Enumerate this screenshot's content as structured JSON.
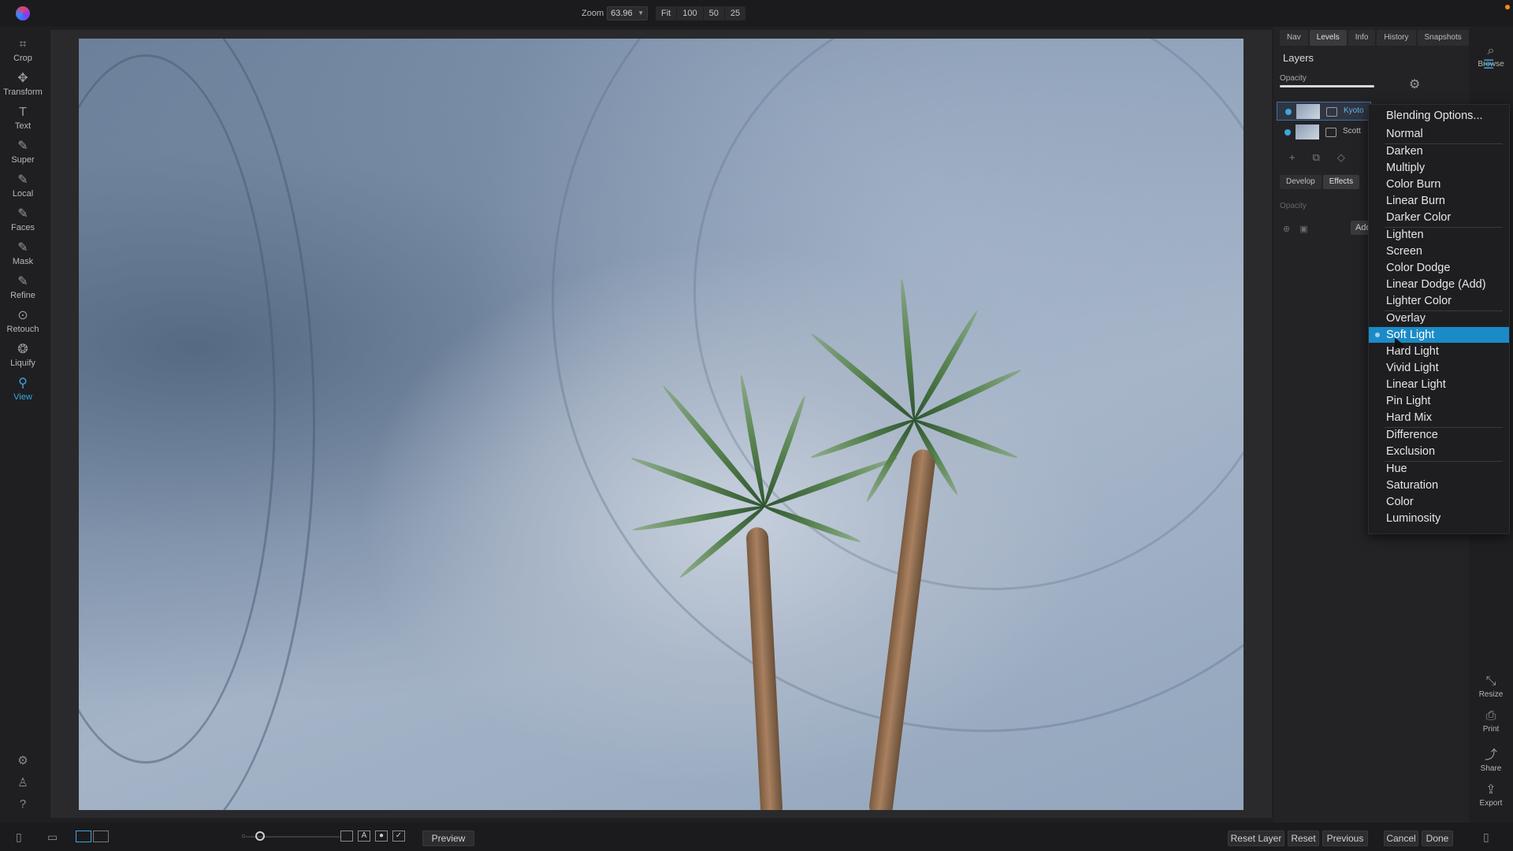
{
  "topbar": {
    "zoom_label": "Zoom",
    "zoom_value": "63.96",
    "zoom_presets": [
      "Fit",
      "100",
      "50",
      "25"
    ]
  },
  "tools": [
    {
      "label": "Crop",
      "icon": "crop-icon",
      "glyph": "⌗"
    },
    {
      "label": "Transform",
      "icon": "transform-icon",
      "glyph": "✥"
    },
    {
      "label": "Text",
      "icon": "text-icon",
      "glyph": "T"
    },
    {
      "label": "Super",
      "icon": "super-brush-icon",
      "glyph": "✎"
    },
    {
      "label": "Local",
      "icon": "local-brush-icon",
      "glyph": "✎"
    },
    {
      "label": "Faces",
      "icon": "faces-icon",
      "glyph": "✎"
    },
    {
      "label": "Mask",
      "icon": "mask-brush-icon",
      "glyph": "✎"
    },
    {
      "label": "Refine",
      "icon": "refine-icon",
      "glyph": "✎"
    },
    {
      "label": "Retouch",
      "icon": "retouch-icon",
      "glyph": "⊙"
    },
    {
      "label": "Liquify",
      "icon": "liquify-icon",
      "glyph": "❂"
    },
    {
      "label": "View",
      "icon": "view-icon",
      "glyph": "⚲"
    }
  ],
  "panel": {
    "tabs": [
      "Nav",
      "Levels",
      "Info",
      "History",
      "Snapshots"
    ],
    "active_tab": "Levels",
    "title": "Layers",
    "opacity_label": "Opacity",
    "layers": [
      {
        "name": "Kyoto",
        "selected": true
      },
      {
        "name": "Scott",
        "selected": false
      }
    ],
    "sub_tabs": [
      "Develop",
      "Effects"
    ],
    "sub_opacity_label": "Opacity",
    "add_label": "Add"
  },
  "right_rail": {
    "browse": "Browse",
    "resize": "Resize",
    "print": "Print",
    "share": "Share",
    "export": "Export"
  },
  "blend_menu": {
    "items": [
      "Blending Options...",
      "Normal",
      "Darken",
      "Multiply",
      "Color Burn",
      "Linear Burn",
      "Darker Color",
      "Lighten",
      "Screen",
      "Color Dodge",
      "Linear Dodge (Add)",
      "Lighter Color",
      "Overlay",
      "Soft Light",
      "Hard Light",
      "Vivid Light",
      "Linear Light",
      "Pin Light",
      "Hard Mix",
      "Difference",
      "Exclusion",
      "Hue",
      "Saturation",
      "Color",
      "Luminosity"
    ],
    "selected": "Soft Light"
  },
  "bottombar": {
    "preview": "Preview",
    "reset_layer": "Reset Layer",
    "reset": "Reset",
    "previous": "Previous",
    "cancel": "Cancel",
    "done": "Done"
  },
  "colors": {
    "accent": "#1b8bc7",
    "active_tool": "#3aa7e0",
    "notification": "#ff8a1e"
  }
}
